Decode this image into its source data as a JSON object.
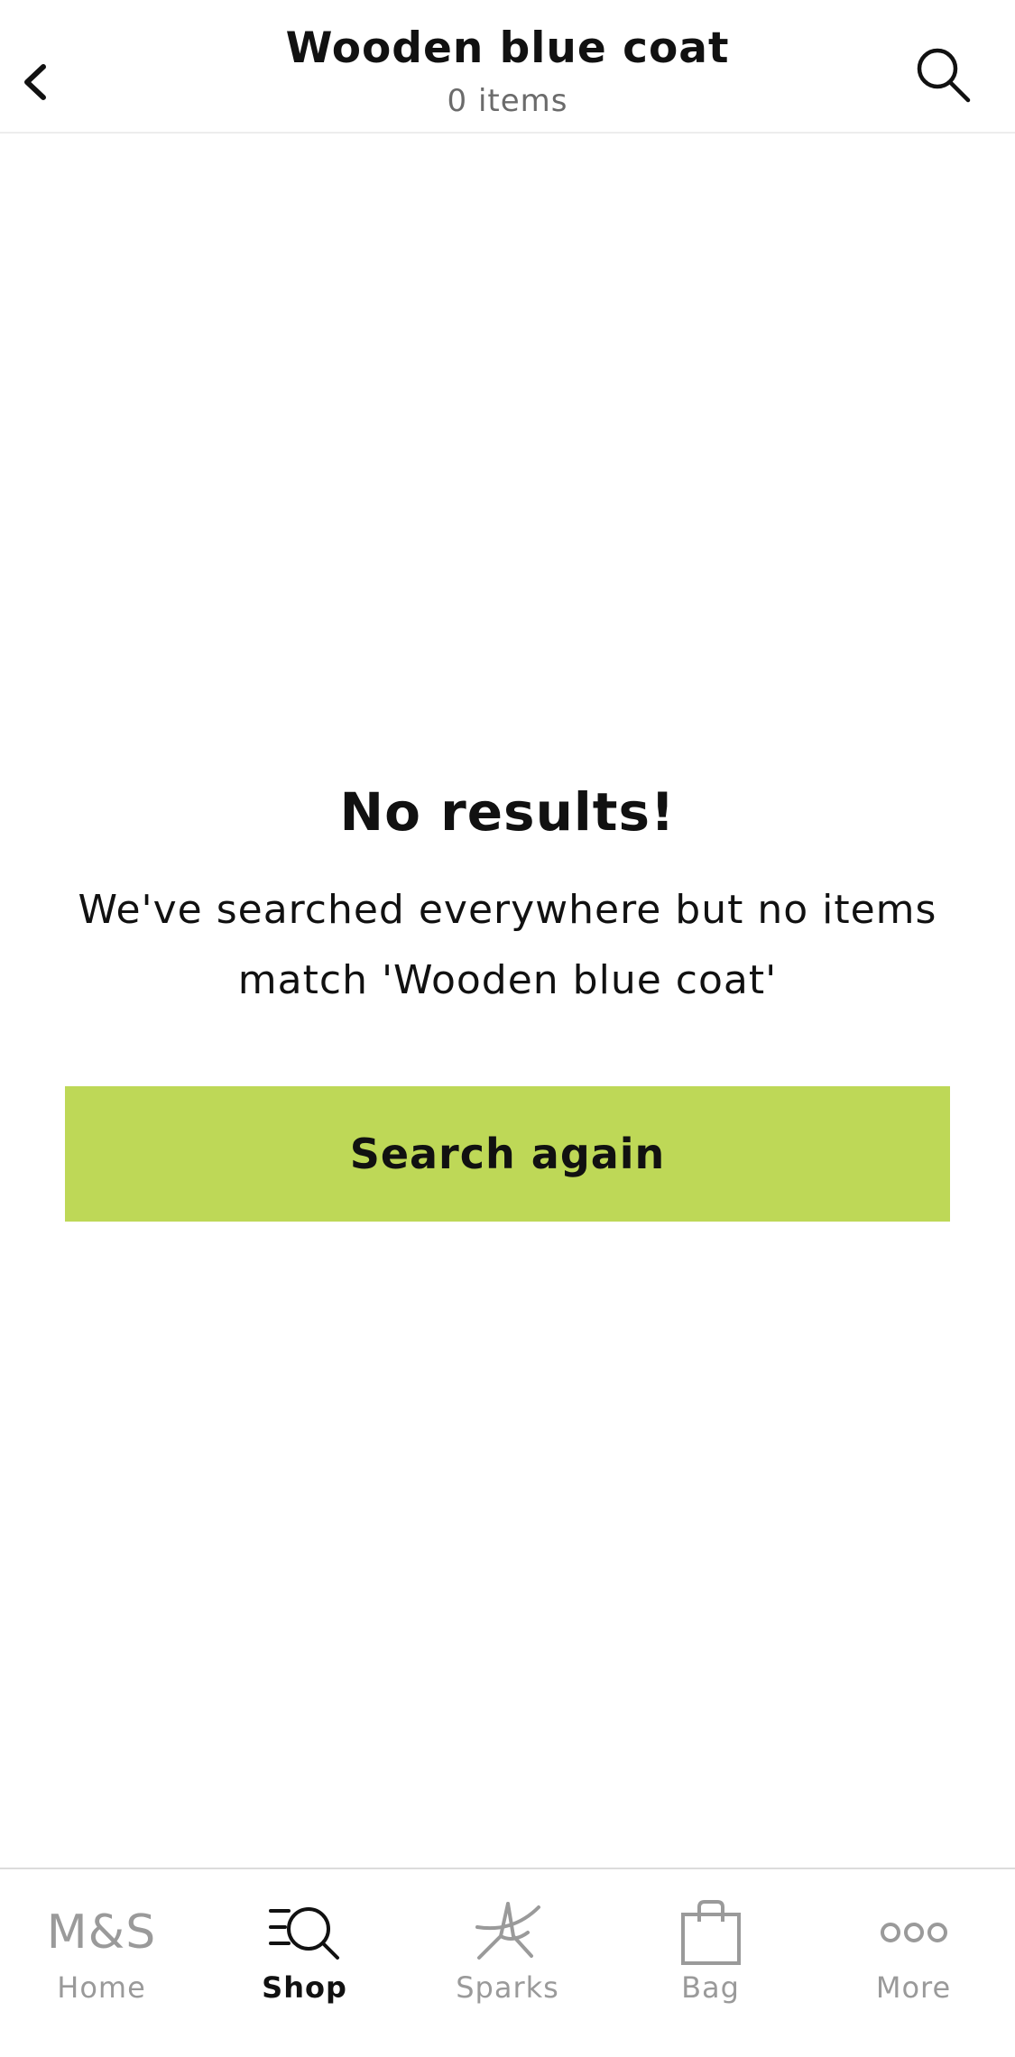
{
  "header": {
    "title": "Wooden blue coat",
    "subtitle": "0 items",
    "back_icon": "chevron-left-icon",
    "search_icon": "search-icon"
  },
  "empty_state": {
    "title": "No results!",
    "message": "We've searched everywhere but no items match 'Wooden blue coat'",
    "button_label": "Search again"
  },
  "tabbar": {
    "tabs": [
      {
        "label": "Home",
        "icon": "ms-logo-icon",
        "icon_text": "M&S",
        "active": false
      },
      {
        "label": "Shop",
        "icon": "shop-search-icon",
        "active": true
      },
      {
        "label": "Sparks",
        "icon": "sparks-star-icon",
        "active": false
      },
      {
        "label": "Bag",
        "icon": "bag-icon",
        "active": false
      },
      {
        "label": "More",
        "icon": "more-dots-icon",
        "active": false
      }
    ]
  },
  "colors": {
    "accent": "#bed857",
    "text": "#111111",
    "muted": "#9a9a9a"
  }
}
